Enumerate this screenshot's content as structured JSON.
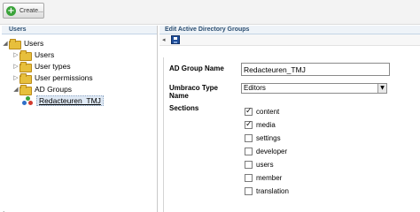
{
  "toolbar": {
    "create_label": "Create..."
  },
  "left_panel": {
    "title": "Users",
    "tree": [
      {
        "label": "Users",
        "depth": 0,
        "expanded": true
      },
      {
        "label": "Users",
        "depth": 1,
        "expanded": false
      },
      {
        "label": "User types",
        "depth": 1,
        "expanded": false
      },
      {
        "label": "User permissions",
        "depth": 1,
        "expanded": false
      },
      {
        "label": "AD Groups",
        "depth": 1,
        "expanded": true
      },
      {
        "label": "Redacteuren_TMJ",
        "depth": 2,
        "selected": true
      }
    ]
  },
  "right_panel": {
    "title": "Edit Active Directory Groups",
    "form": {
      "group_name_label": "AD Group Name",
      "group_name_value": "Redacteuren_TMJ",
      "type_label": "Umbraco Type Name",
      "type_value": "Editors",
      "sections_label": "Sections",
      "sections": [
        {
          "label": "content",
          "checked": true
        },
        {
          "label": "media",
          "checked": true
        },
        {
          "label": "settings",
          "checked": false
        },
        {
          "label": "developer",
          "checked": false
        },
        {
          "label": "users",
          "checked": false
        },
        {
          "label": "member",
          "checked": false
        },
        {
          "label": "translation",
          "checked": false
        }
      ]
    }
  },
  "icons": {
    "create": "plus-circle-icon",
    "folder": "folder-icon",
    "group": "user-group-icon",
    "save": "floppy-disk-icon",
    "back": "back-arrow-icon"
  },
  "colors": {
    "header_text": "#2c4f72",
    "folder": "#e7bf3c",
    "save_icon": "#1f4f9b",
    "create_icon": "#3aa33a"
  }
}
